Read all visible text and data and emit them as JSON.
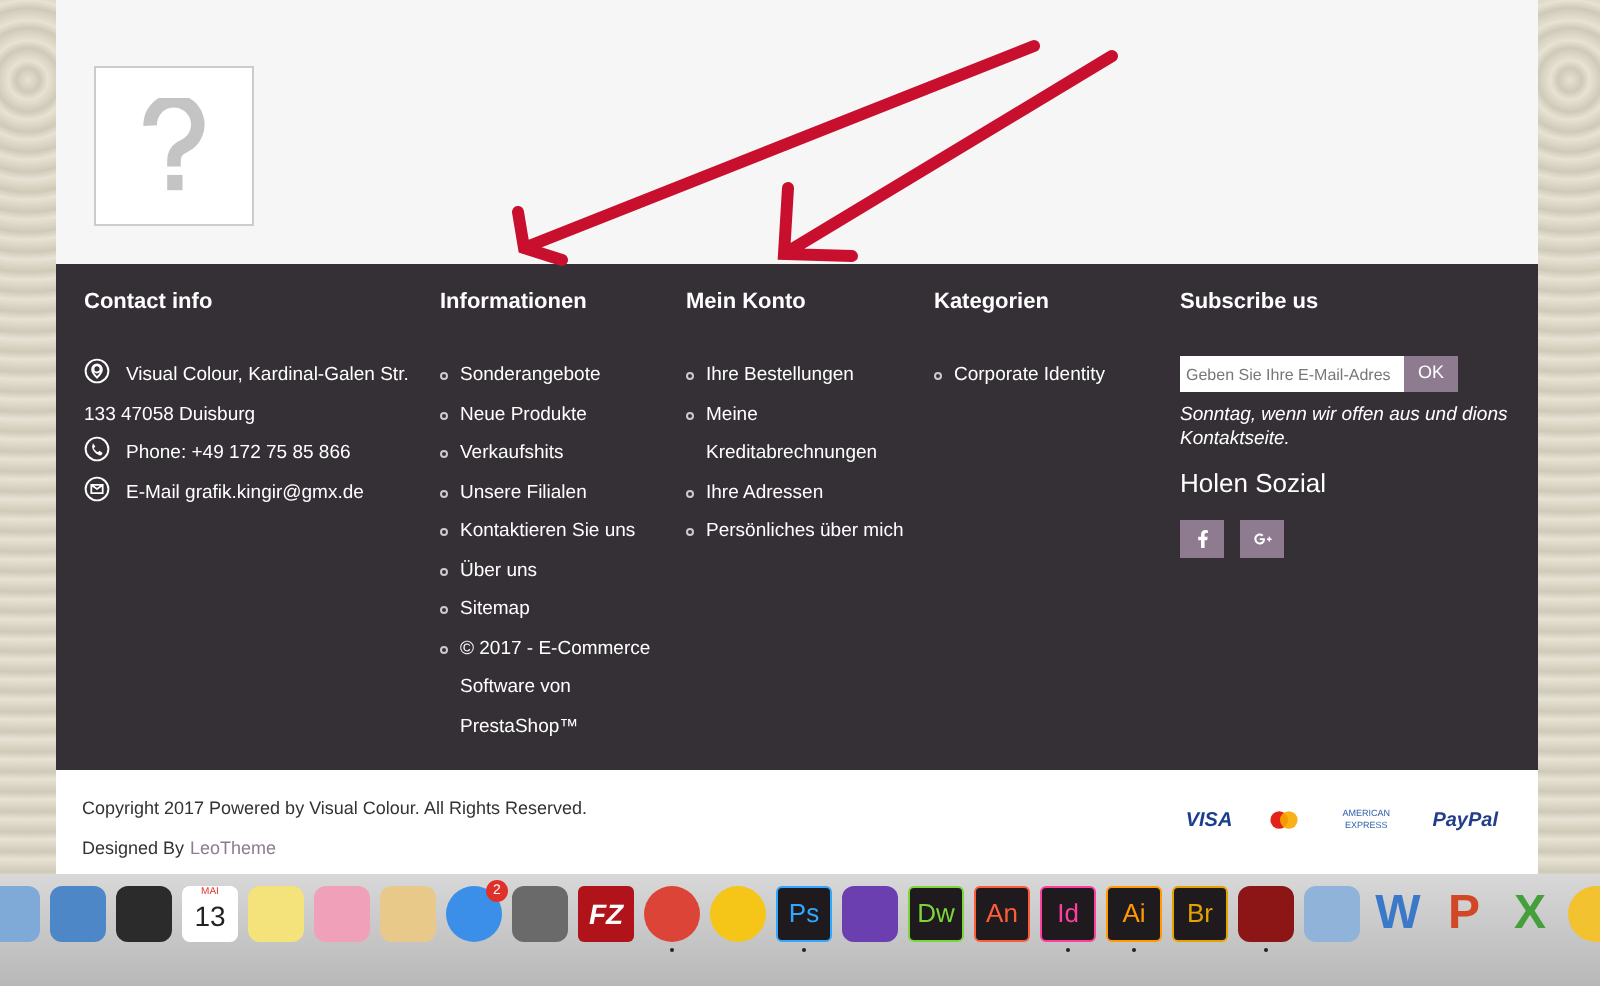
{
  "footer": {
    "columns": [
      {
        "title": "Contact info",
        "kind": "contact",
        "items": [
          {
            "kind": "address",
            "text": "Visual Colour, Kardinal-Galen Str. 133 47058 Duisburg"
          },
          {
            "kind": "phone",
            "text": "Phone: +49 172 75 85 866"
          },
          {
            "kind": "email",
            "text": "E-Mail grafik.kingir@gmx.de"
          }
        ]
      },
      {
        "title": "Informationen",
        "kind": "links",
        "items": [
          "Sonderangebote",
          "Neue Produkte",
          "Verkaufshits",
          "Unsere Filialen",
          "Kontaktieren Sie uns",
          "Über uns",
          "Sitemap",
          "© 2017 - E-Commerce Software von PrestaShop™"
        ]
      },
      {
        "title": "Mein Konto",
        "kind": "links",
        "items": [
          "Ihre Bestellungen",
          "Meine Kreditabrechnungen",
          "Ihre Adressen",
          "Persönliches über mich"
        ]
      },
      {
        "title": "Kategorien",
        "kind": "links",
        "items": [
          "Corporate Identity"
        ]
      },
      {
        "title": "Subscribe us",
        "kind": "subscribe",
        "placeholder": "Geben Sie Ihre E-Mail-Adres",
        "button": "OK",
        "note": "Sonntag, wenn wir offen aus und dions Kontaktseite.",
        "social_title": "Holen Sozial",
        "social": [
          {
            "kind": "facebook"
          },
          {
            "kind": "google-plus"
          }
        ]
      }
    ]
  },
  "bottom": {
    "copyright": "Copyright 2017 Powered by Visual Colour. All Rights Reserved.",
    "designed_by": "Designed By",
    "designer_link": "LeoTheme",
    "payments": [
      {
        "kind": "visa",
        "label": "VISA"
      },
      {
        "kind": "mastercard"
      },
      {
        "kind": "amex",
        "label": "AMERICAN EXPRESS"
      },
      {
        "kind": "paypal",
        "label": "PayPal"
      }
    ]
  },
  "dock": [
    {
      "kind": "plain",
      "color": "#7fa9d6",
      "running": false
    },
    {
      "kind": "plain",
      "color": "#4d87c7",
      "running": false
    },
    {
      "kind": "plain",
      "color": "#2b2b2b",
      "running": false
    },
    {
      "kind": "calendar",
      "month": "MAI",
      "label": "13",
      "running": false
    },
    {
      "kind": "plain",
      "color": "#f4e27a",
      "running": false
    },
    {
      "kind": "plain",
      "color": "#f0a0b8",
      "running": false
    },
    {
      "kind": "plain",
      "color": "#e9c98a",
      "running": false
    },
    {
      "kind": "badge",
      "color": "#3b8fe8",
      "badge": "2",
      "running": false
    },
    {
      "kind": "plain",
      "color": "#6a6a6a",
      "running": false
    },
    {
      "kind": "solid",
      "color": "#b0141a",
      "label": "FZ",
      "running": false
    },
    {
      "kind": "round",
      "color": "#db4437",
      "running": true
    },
    {
      "kind": "round",
      "color": "#f5c518",
      "running": false
    },
    {
      "kind": "tile",
      "color": "#31a8ff",
      "label": "Ps",
      "running": true
    },
    {
      "kind": "plain",
      "color": "#6b3fb0",
      "running": false
    },
    {
      "kind": "tile",
      "color": "#7cd639",
      "label": "Dw",
      "running": false
    },
    {
      "kind": "tile",
      "color": "#ff5c39",
      "label": "An",
      "running": false
    },
    {
      "kind": "tile",
      "color": "#ff3fa0",
      "label": "Id",
      "running": true
    },
    {
      "kind": "tile",
      "color": "#ff9a00",
      "label": "Ai",
      "running": true
    },
    {
      "kind": "tile",
      "color": "#e6a300",
      "label": "Br",
      "running": false
    },
    {
      "kind": "plain",
      "color": "#8c1616",
      "running": true
    },
    {
      "kind": "plain",
      "color": "#8fb3d9",
      "running": false
    },
    {
      "kind": "letter",
      "color": "#3a78c8",
      "label": "W",
      "running": false
    },
    {
      "kind": "letter",
      "color": "#d24726",
      "label": "P",
      "running": false
    },
    {
      "kind": "letter",
      "color": "#44a03a",
      "label": "X",
      "running": false
    },
    {
      "kind": "round",
      "color": "#f2c230",
      "running": false
    }
  ]
}
